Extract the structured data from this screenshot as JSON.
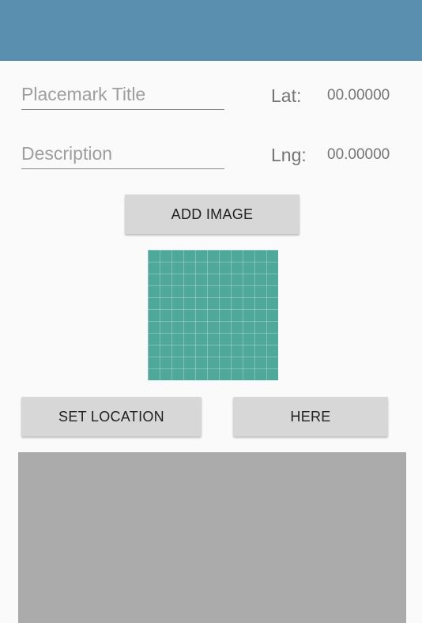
{
  "form": {
    "title_placeholder": "Placemark Title",
    "description_placeholder": "Description",
    "lat_label": "Lat:",
    "lat_value": "00.00000",
    "lng_label": "Lng:",
    "lng_value": "00.00000"
  },
  "buttons": {
    "add_image": "ADD IMAGE",
    "set_location": "SET LOCATION",
    "here": "HERE"
  },
  "colors": {
    "app_bar": "#5b8fb0",
    "background": "#fafafa",
    "button": "#d7d7d7",
    "image_preview": "#4fa89a",
    "map_placeholder": "#ababab"
  }
}
